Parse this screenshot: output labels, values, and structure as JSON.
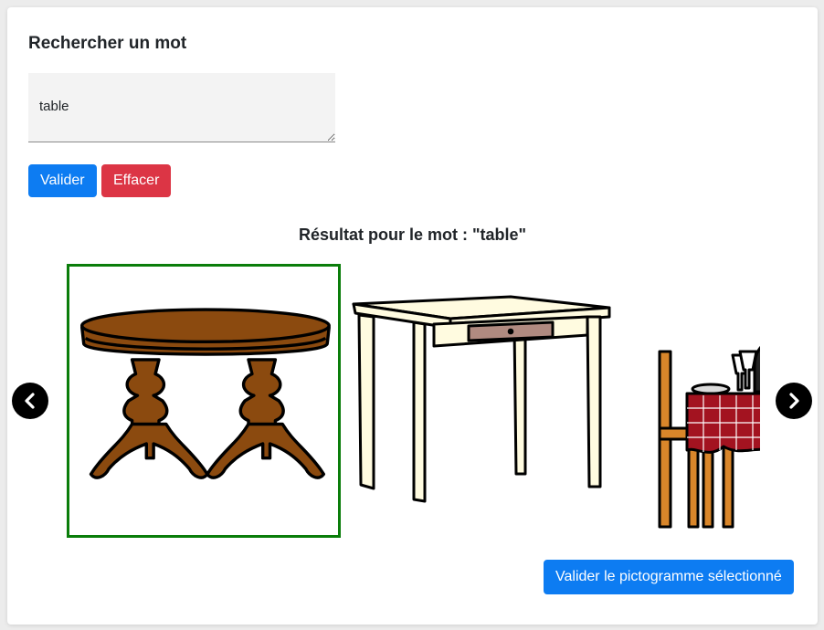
{
  "search": {
    "heading": "Rechercher un mot",
    "value": "table"
  },
  "buttons": {
    "validate": "Valider",
    "clear": "Effacer",
    "confirm_pictogram": "Valider le pictogramme sélectionné"
  },
  "results": {
    "heading": "Résultat pour le mot : \"table\"",
    "pictograms": [
      {
        "icon": "round-wooden-table-icon",
        "selected": true
      },
      {
        "icon": "desk-table-with-drawer-icon",
        "selected": false
      },
      {
        "icon": "restaurant-table-icon",
        "selected": false
      }
    ]
  },
  "colors": {
    "primary": "#0d7cf2",
    "danger": "#dc3545",
    "selected_border": "#0a7d0a"
  },
  "icons": {
    "prev": "chevron-left-icon",
    "next": "chevron-right-icon"
  }
}
